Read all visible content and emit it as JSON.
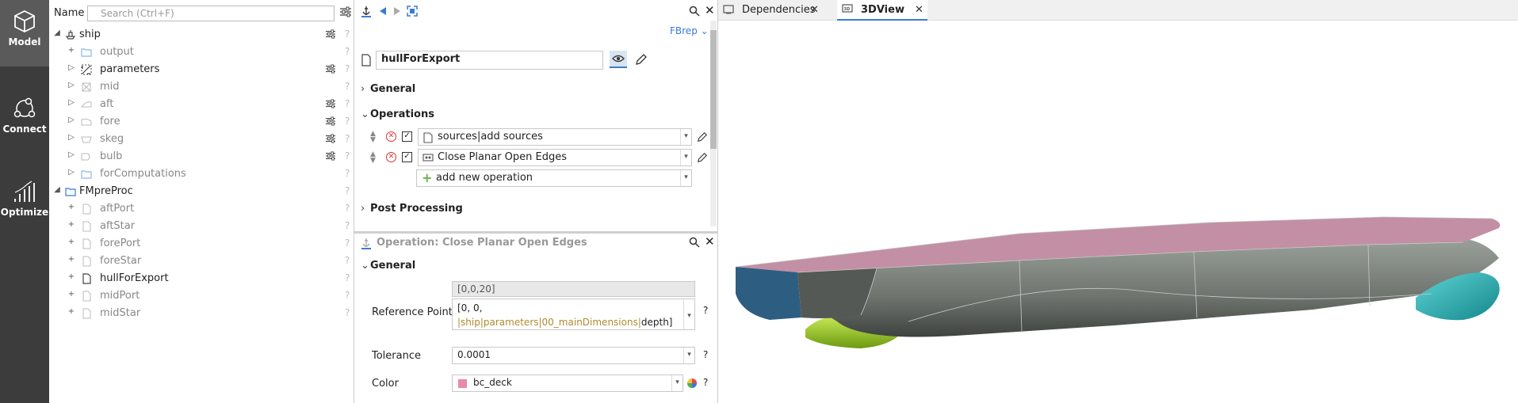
{
  "leftbar": {
    "items": [
      {
        "label": "Model"
      },
      {
        "label": "Connect"
      },
      {
        "label": "Optimize"
      }
    ]
  },
  "tree": {
    "name_label": "Name",
    "search_placeholder": "Search (Ctrl+F)",
    "rows": [
      {
        "label": "ship"
      },
      {
        "label": "output"
      },
      {
        "label": "parameters"
      },
      {
        "label": "mid"
      },
      {
        "label": "aft"
      },
      {
        "label": "fore"
      },
      {
        "label": "skeg"
      },
      {
        "label": "bulb"
      },
      {
        "label": "forComputations"
      },
      {
        "label": "FMpreProc"
      },
      {
        "label": "aftPort"
      },
      {
        "label": "aftStar"
      },
      {
        "label": "forePort"
      },
      {
        "label": "foreStar"
      },
      {
        "label": "hullForExport"
      },
      {
        "label": "midPort"
      },
      {
        "label": "midStar"
      }
    ],
    "question": "?"
  },
  "editor": {
    "mode": "FBrep",
    "object_name": "hullForExport",
    "sections": {
      "general": "General",
      "operations": "Operations",
      "post_processing": "Post Processing"
    },
    "operations": [
      {
        "label": "sources|add sources"
      },
      {
        "label": "Close Planar Open Edges"
      }
    ],
    "add_operation": "add new operation"
  },
  "operation_panel": {
    "title": "Operation: Close Planar Open Edges",
    "general": "General",
    "grey_value": "[0,0,20]",
    "reference_point_label": "Reference Point",
    "reference_point_value_prefix": "[0, 0, ",
    "reference_point_ref": "|ship|parameters|00_mainDimensions|",
    "reference_point_suffix": "depth]",
    "tolerance_label": "Tolerance",
    "tolerance_value": "0.0001",
    "color_label": "Color",
    "color_value": "bc_deck",
    "help": "?"
  },
  "tabs": [
    {
      "label": "Dependencies"
    },
    {
      "label": "3DView"
    }
  ],
  "colors": {
    "sidebar": "#3c3c3c",
    "accent": "#3a7bd5",
    "deck": "#c38fa4",
    "hull": "#7a7f7a",
    "bulb": "#2ab4b8",
    "skeg": "#a4d232",
    "stern": "#2e5d82"
  }
}
